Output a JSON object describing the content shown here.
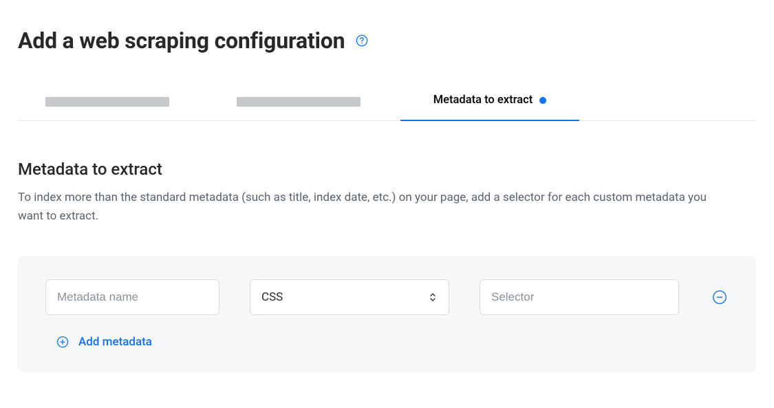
{
  "title": "Add a web scraping configuration",
  "tabs": {
    "active_index": 2,
    "items": [
      {
        "label": "",
        "placeholder": true
      },
      {
        "label": "",
        "placeholder": true
      },
      {
        "label": "Metadata to extract",
        "placeholder": false,
        "has_indicator": true
      }
    ]
  },
  "section": {
    "heading": "Metadata to extract",
    "description": "To index more than the standard metadata (such as title, index date, etc.) on your page, add a selector for each custom metadata you want to extract."
  },
  "form": {
    "rows": [
      {
        "name_placeholder": "Metadata name",
        "name_value": "",
        "type_value": "CSS",
        "selector_placeholder": "Selector",
        "selector_value": ""
      }
    ],
    "add_label": "Add metadata"
  },
  "colors": {
    "accent": "#1372ec"
  }
}
